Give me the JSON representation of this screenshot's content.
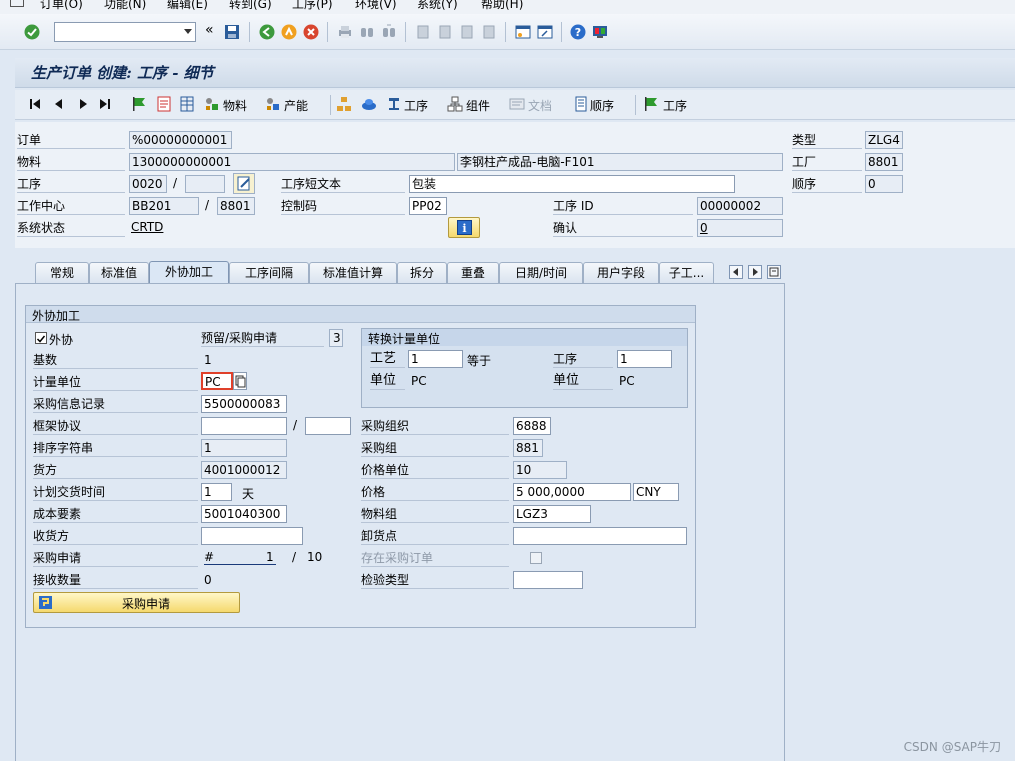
{
  "menu": [
    "订单(O)",
    "功能(N)",
    "编辑(E)",
    "转到(G)",
    "工序(P)",
    "环境(V)",
    "系统(Y)",
    "帮助(H)"
  ],
  "toolbar": {
    "command_value": "",
    "icons": [
      "enter-icon",
      "back-icon",
      "exit-icon",
      "cancel-icon",
      "save-icon",
      "print-icon",
      "find-icon",
      "create-session-icon",
      "help-icon",
      "customize-icon"
    ]
  },
  "title": "生产订单 创建: 工序 - 细节",
  "app_toolbar": {
    "material": "物料",
    "production_resource": "产能",
    "operation": "工序",
    "component": "组件",
    "document": "文档",
    "sequence": "顺序",
    "operation2": "工序"
  },
  "header": {
    "order_label": "订单",
    "order_value": "%00000000001",
    "material_label": "物料",
    "material_value": "1300000000001",
    "material_desc": "李钢柱产成品-电脑-F101",
    "operation_label": "工序",
    "operation_value": "0020",
    "operation_sep": "/",
    "operation_sub": "",
    "op_short_text_label": "工序短文本",
    "op_short_text_value": "包装",
    "work_center_label": "工作中心",
    "work_center_value": "BB201",
    "work_center_sep": "/",
    "work_center_plant": "8801",
    "control_key_label": "控制码",
    "control_key_value": "PP02",
    "op_id_label": "工序 ID",
    "op_id_value": "00000002",
    "system_status_label": "系统状态",
    "system_status_value": "CRTD",
    "confirm_label": "确认",
    "confirm_value": "0",
    "type_label": "类型",
    "type_value": "ZLG4",
    "plant_label": "工厂",
    "plant_value": "8801",
    "sequence_label": "顺序",
    "sequence_value": "0"
  },
  "tabs": [
    "常规",
    "标准值",
    "外协加工",
    "工序间隔",
    "标准值计算",
    "拆分",
    "重叠",
    "日期/时间",
    "用户字段",
    "子工..."
  ],
  "active_tab": "外协加工",
  "group": {
    "title": "外协加工",
    "subcontracting_label": "外协",
    "subcontracting_checked": true,
    "pr_label": "预留/采购申请",
    "pr_value": "3",
    "base_qty_label": "基数",
    "base_qty_value": "1",
    "unit_label": "计量单位",
    "unit_value": "PC",
    "info_record_label": "采购信息记录",
    "info_record_value": "5500000083",
    "outline_label": "框架协议",
    "outline_value": "",
    "outline_sep": "/",
    "outline_item": "",
    "sort_label": "排序字符串",
    "sort_value": "1",
    "vendor_label": "货方",
    "vendor_value": "4001000012",
    "delivery_time_label": "计划交货时间",
    "delivery_time_value": "1",
    "delivery_time_unit": "天",
    "cost_element_label": "成本要素",
    "cost_element_value": "5001040300",
    "recipient_label": "收货方",
    "recipient_value": "",
    "purch_req_label": "采购申请",
    "purch_req_value": "#",
    "purch_req_item": "1",
    "purch_req_sep": "/",
    "purch_req_total": "10",
    "gr_qty_label": "接收数量",
    "gr_qty_value": "0",
    "purch_org_label": "采购组织",
    "purch_org_value": "6888",
    "purch_group_label": "采购组",
    "purch_group_value": "881",
    "price_unit_label": "价格单位",
    "price_unit_value": "10",
    "price_label": "价格",
    "price_value": "5 000,0000",
    "currency_value": "CNY",
    "mat_group_label": "物料组",
    "mat_group_value": "LGZ3",
    "unloading_label": "卸货点",
    "unloading_value": "",
    "in_po_label": "存在采购订单",
    "inspection_label": "检验类型",
    "inspection_value": "",
    "button_label": "采购申请"
  },
  "conversion": {
    "title": "转换计量单位",
    "process_label": "工艺",
    "process_value": "1",
    "equals": "等于",
    "op_label": "工序",
    "op_value": "1",
    "unit_label_1": "单位",
    "unit_value_1": "PC",
    "unit_label_2": "单位",
    "unit_value_2": "PC"
  },
  "watermark": "CSDN @SAP牛刀"
}
